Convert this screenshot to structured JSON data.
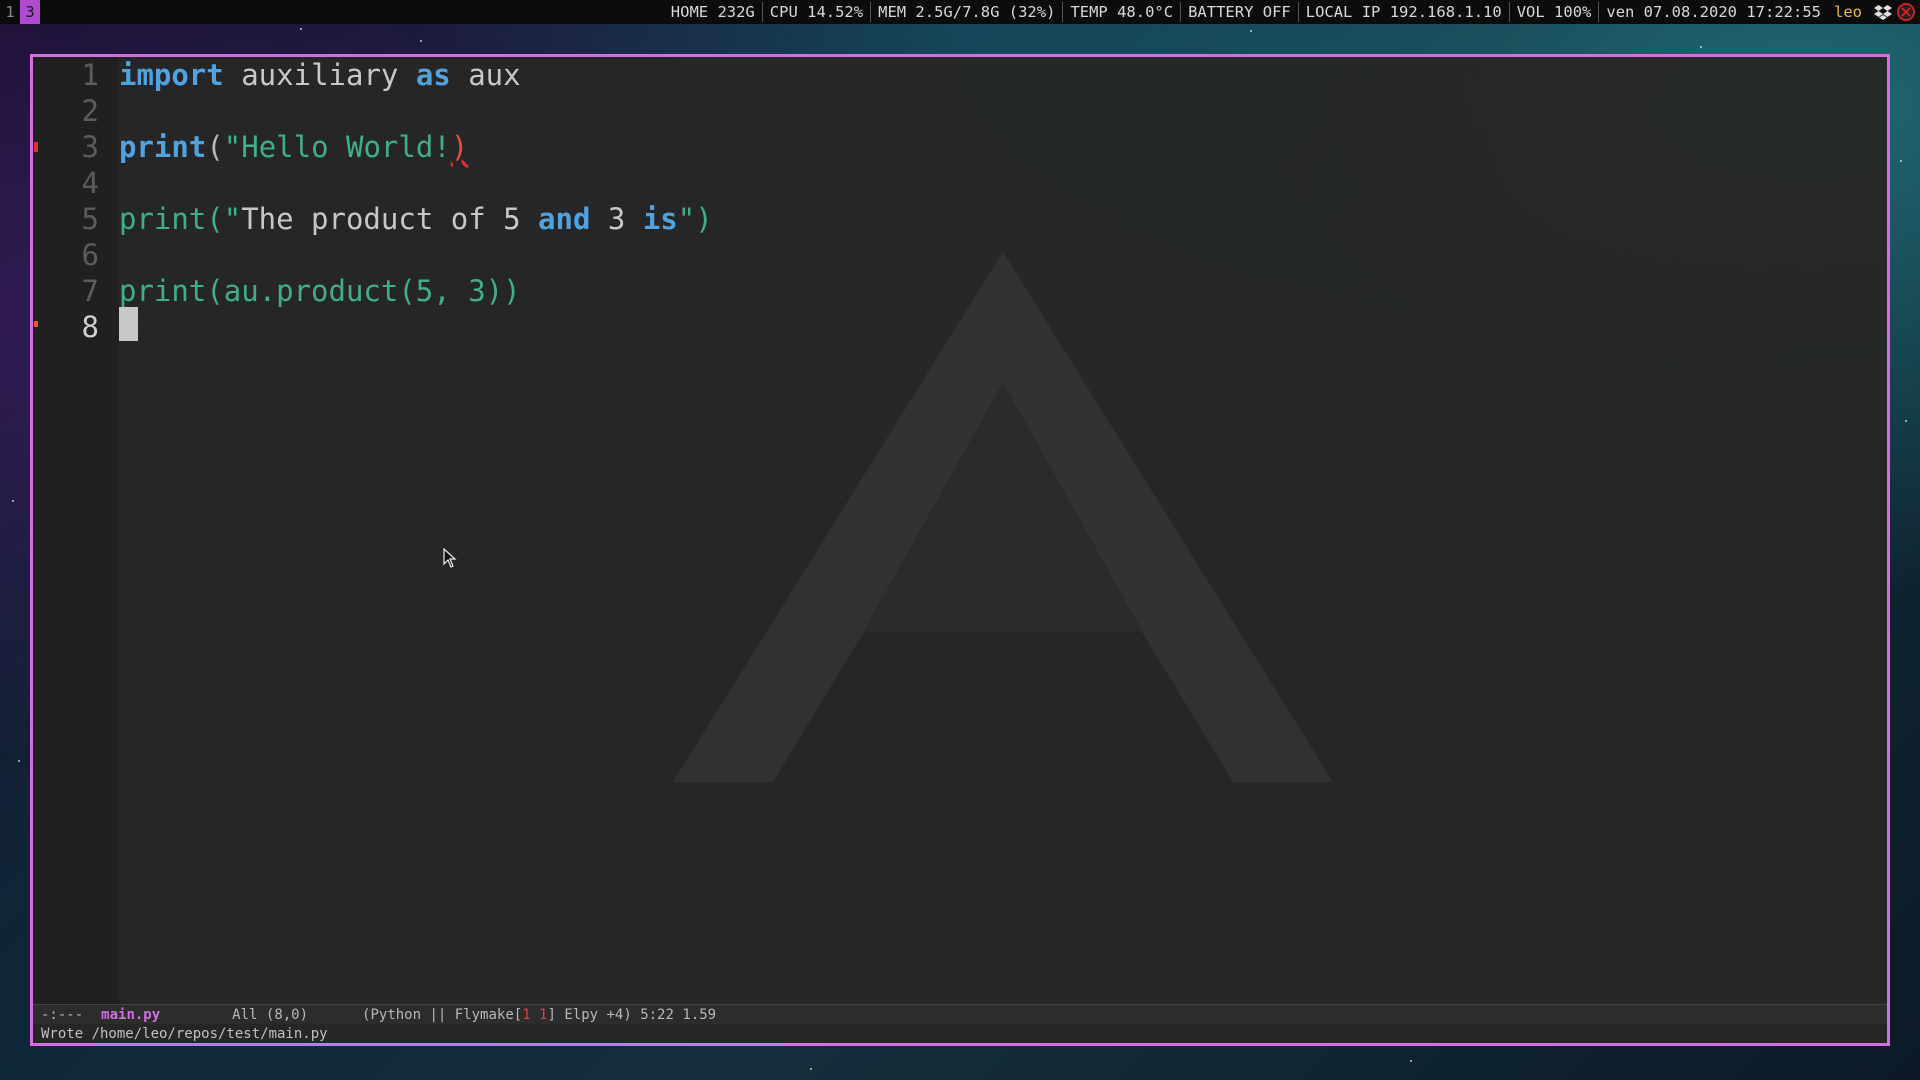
{
  "topbar": {
    "workspaces": [
      {
        "label": "1",
        "active": false
      },
      {
        "label": "3",
        "active": true
      }
    ],
    "status": [
      "HOME 232G",
      "CPU 14.52%",
      "MEM 2.5G/7.8G (32%)",
      "TEMP 48.0°C",
      "BATTERY OFF",
      "LOCAL IP 192.168.1.10",
      "VOL 100%",
      "ven 07.08.2020 17:22:55"
    ],
    "user": "leo",
    "tray_icons": [
      "dropbox-icon",
      "network-error-icon"
    ]
  },
  "editor": {
    "lines": [
      {
        "num": "1",
        "tokens": [
          {
            "t": "import",
            "c": "kw"
          },
          {
            "t": " auxiliary ",
            "c": "txt"
          },
          {
            "t": "as",
            "c": "kw"
          },
          {
            "t": " aux",
            "c": "txt"
          }
        ]
      },
      {
        "num": "2",
        "tokens": []
      },
      {
        "num": "3",
        "tokens": [
          {
            "t": "print",
            "c": "kw"
          },
          {
            "t": "(",
            "c": "paren"
          },
          {
            "t": "\"Hello World!",
            "c": "str"
          },
          {
            "t": ")",
            "c": "err"
          }
        ]
      },
      {
        "num": "4",
        "tokens": []
      },
      {
        "num": "5",
        "tokens": [
          {
            "t": "print(\"",
            "c": "green"
          },
          {
            "t": "The product of 5 ",
            "c": "txt"
          },
          {
            "t": "and",
            "c": "kw"
          },
          {
            "t": " 3 ",
            "c": "txt"
          },
          {
            "t": "is",
            "c": "kw"
          },
          {
            "t": "\")",
            "c": "green"
          }
        ]
      },
      {
        "num": "6",
        "tokens": []
      },
      {
        "num": "7",
        "tokens": [
          {
            "t": "print(au.product(5, 3))",
            "c": "green"
          }
        ]
      },
      {
        "num": "8",
        "tokens": [],
        "cursor": true,
        "current": true
      }
    ]
  },
  "modeline": {
    "state": "-:---",
    "filename": "main.py",
    "position": "All (8,0)",
    "modes_prefix": "(Python || Flymake[",
    "flymake_errors": "1 1",
    "modes_suffix": "] Elpy +4) 5:22 1.59"
  },
  "minibuffer": {
    "message": "Wrote /home/leo/repos/test/main.py"
  },
  "colors": {
    "frame_border": "#d36fe0",
    "keyword": "#4fa3e0",
    "string": "#3fae8a",
    "active_workspace": "#b04ad0",
    "user": "#e8b84a"
  }
}
